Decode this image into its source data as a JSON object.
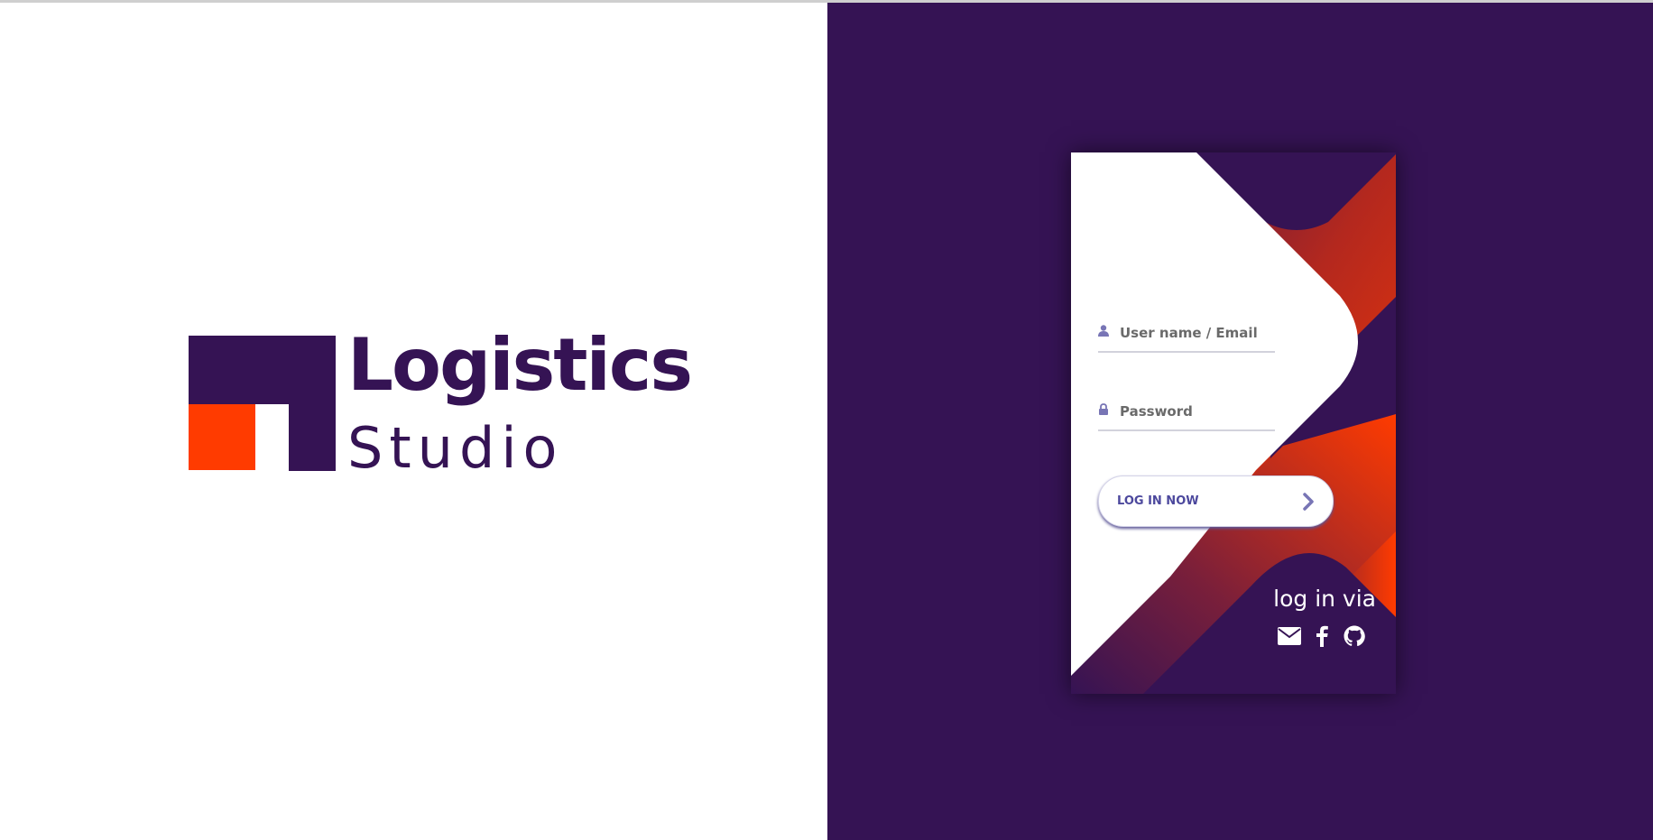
{
  "brand": {
    "title": "Logistics",
    "subtitle": "Studio",
    "colors": {
      "primary": "#351354",
      "accent": "#ff3b00"
    }
  },
  "login": {
    "username_placeholder": "User name / Email",
    "password_placeholder": "Password",
    "button_label": "LOG IN NOW",
    "button_icon": "chevron-right-icon",
    "social_title": "log in via",
    "social_icons": [
      "envelope-icon",
      "facebook-icon",
      "github-icon"
    ],
    "colors": {
      "background": "#351354",
      "button_text": "#4c489d",
      "icon": "#7875b5",
      "orange": "#ff3b00"
    }
  }
}
